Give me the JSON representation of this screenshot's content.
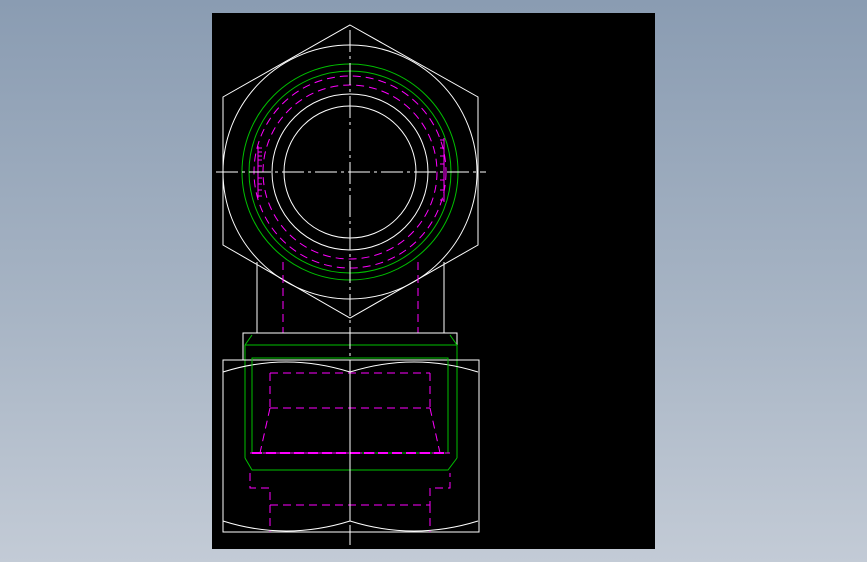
{
  "drawing": {
    "background": "#000000",
    "colors": {
      "outline": "#ffffff",
      "thread": "#00c000",
      "hidden": "#ff00ff",
      "centerline": "#ffffff"
    },
    "views": [
      "top-view",
      "front-view"
    ],
    "thread_mark": "thread"
  }
}
